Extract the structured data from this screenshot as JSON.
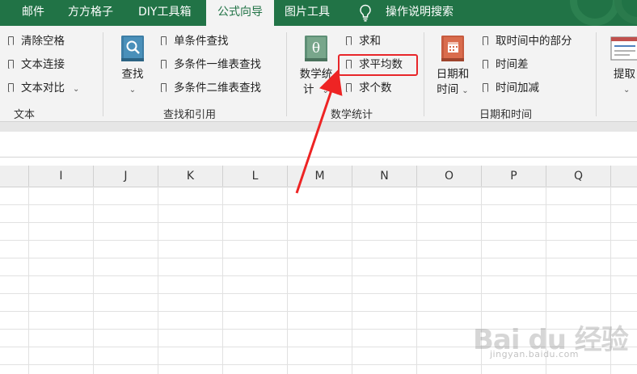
{
  "tabs": [
    "邮件",
    "方方格子",
    "DIY工具箱",
    "公式向导",
    "图片工具",
    "操作说明搜索"
  ],
  "active_tab": "公式向导",
  "colors": {
    "brand": "#217346",
    "highlight": "#e8262a",
    "arrow": "#ee2424"
  },
  "ribbon": {
    "text_group": {
      "items": [
        "清除空格",
        "文本连接",
        "文本对比"
      ],
      "label": "文本"
    },
    "lookup_group": {
      "big_button": "查找",
      "items": [
        "单条件查找",
        "多条件一维表查找",
        "多条件二维表查找"
      ],
      "label": "查找和引用"
    },
    "math_group": {
      "big_button_line1": "数学统",
      "big_button_line2": "计",
      "items": [
        "求和",
        "求平均数",
        "求个数"
      ],
      "label": "数学统计"
    },
    "date_group": {
      "big_button_line1": "日期和",
      "big_button_line2": "时间",
      "items": [
        "取时间中的部分",
        "时间差",
        "时间加减"
      ],
      "label": "日期和时间"
    },
    "extract_button": "提取"
  },
  "grid": {
    "columns": [
      "I",
      "J",
      "K",
      "L",
      "M",
      "N",
      "O",
      "P",
      "Q"
    ]
  },
  "watermark": {
    "logo": "Bai du 经验",
    "url": "jingyan.baidu.com"
  }
}
